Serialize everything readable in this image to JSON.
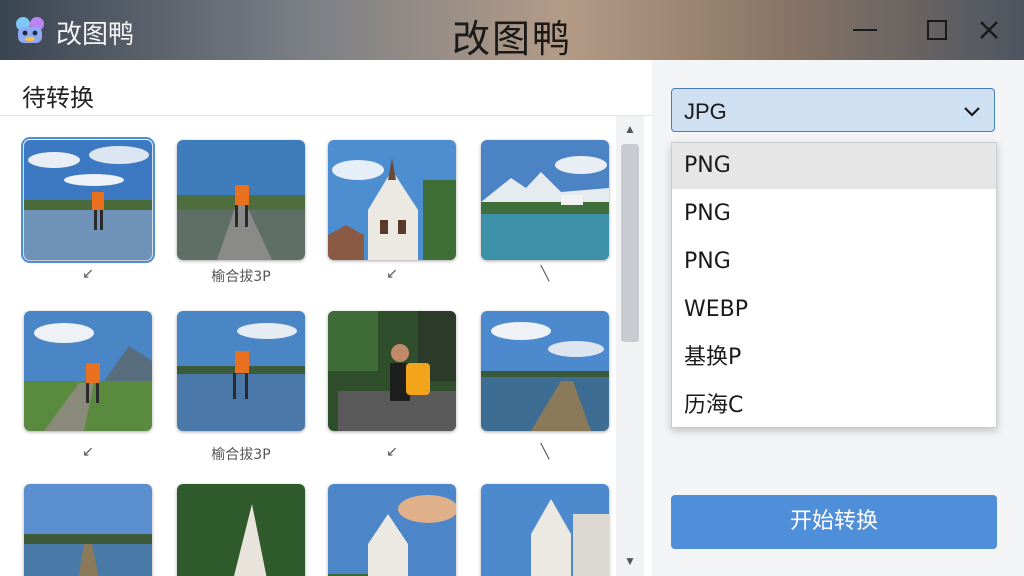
{
  "app": {
    "name": "改图鸭",
    "window_title": "改图鸭",
    "icon": "duck-logo-icon"
  },
  "window_controls": [
    "minimize-icon",
    "maximize-icon",
    "close-icon"
  ],
  "left_panel": {
    "title": "待转换",
    "captions": [
      "↙",
      "榆合拔3P",
      "↙",
      "╲",
      "↙",
      "榆合拔3P",
      "↙",
      "╲"
    ]
  },
  "format_select": {
    "value": "JPG",
    "options": [
      "PNG",
      "PNG",
      "PNG",
      "WEBP",
      "基换P",
      "历海C"
    ]
  },
  "start_button": "开始转换",
  "colors": {
    "accent": "#4f8ed8",
    "select_bg": "#cfe0f3",
    "select_border": "#4a7fb5"
  }
}
